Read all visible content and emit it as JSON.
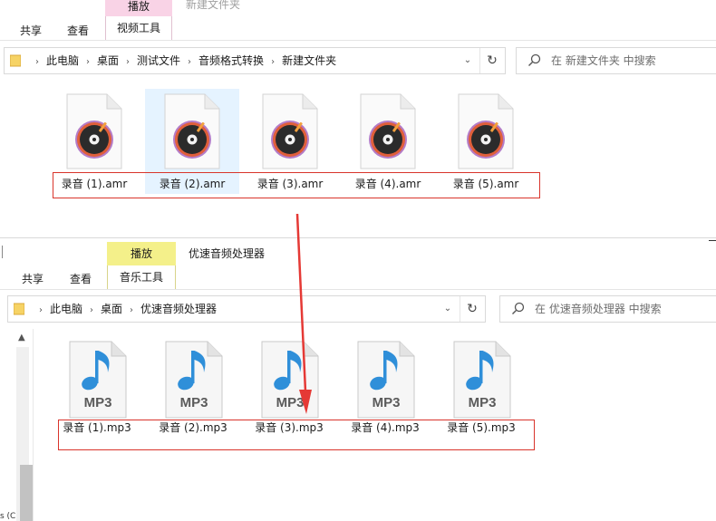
{
  "top_window": {
    "ribbon_tabs": [
      "共享",
      "查看"
    ],
    "context_group": "播放",
    "context_tab": "视频工具",
    "title": "新建文件夹",
    "breadcrumb": [
      "此电脑",
      "桌面",
      "测试文件",
      "音频格式转换",
      "新建文件夹"
    ],
    "search_placeholder": "在 新建文件夹 中搜索",
    "files": [
      "录音 (1).amr",
      "录音 (2).amr",
      "录音 (3).amr",
      "录音 (4).amr",
      "录音 (5).amr"
    ]
  },
  "bottom_window": {
    "ribbon_tabs": [
      "共享",
      "查看"
    ],
    "context_group": "播放",
    "context_tab": "音乐工具",
    "title": "优速音频处理器",
    "breadcrumb": [
      "此电脑",
      "桌面",
      "优速音频处理器"
    ],
    "search_placeholder": "在 优速音频处理器 中搜索",
    "files": [
      "录音 (1).mp3",
      "录音 (2).mp3",
      "录音 (3).mp3",
      "录音 (4).mp3",
      "录音 (5).mp3"
    ],
    "file_badge": "MP3"
  },
  "icons": {
    "breadcrumb_separator": "›",
    "dropdown": "⌄",
    "refresh": "↻",
    "scroll_up": "▲"
  },
  "colors": {
    "annotation_red": "#d9342b",
    "selection_blue": "#e5f3ff",
    "video_tools_pink": "#f9d3e6",
    "music_tools_yellow": "#f4f08a",
    "note_blue": "#2f8fd9"
  }
}
